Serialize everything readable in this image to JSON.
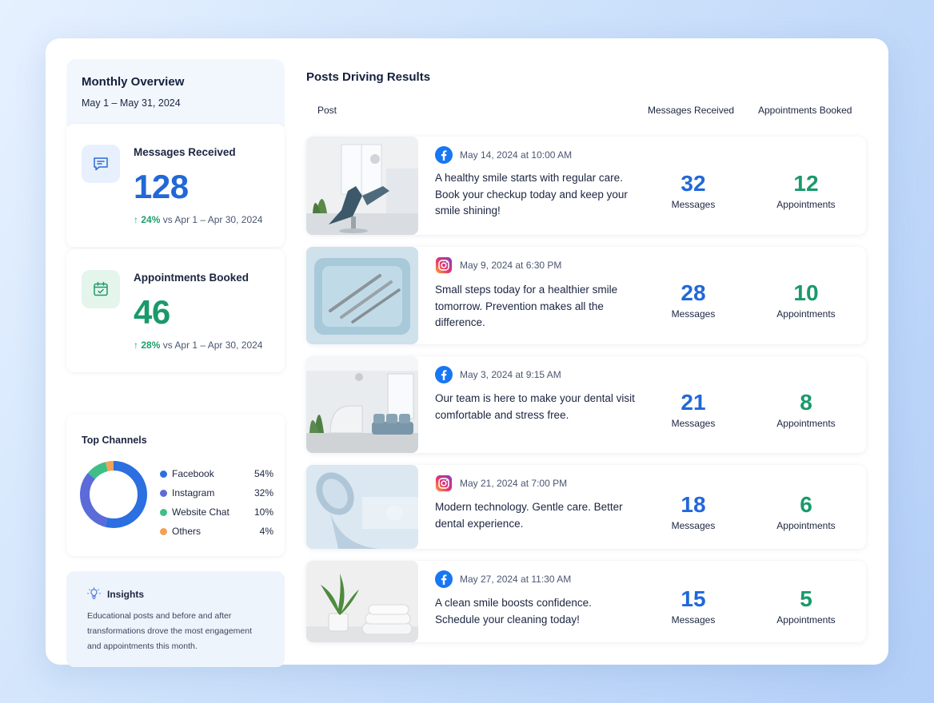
{
  "overview": {
    "title": "Monthly Overview",
    "date_range": "May 1 – May 31, 2024"
  },
  "stats": [
    {
      "label": "Messages Received",
      "value": "128",
      "change_pct": "24%",
      "change_text": "vs Apr 1 – Apr 30, 2024",
      "icon": "chat-icon",
      "color": "#2168d8"
    },
    {
      "label": "Appointments Booked",
      "value": "46",
      "change_pct": "28%",
      "change_text": "vs Apr 1 – Apr 30, 2024",
      "icon": "calendar-icon",
      "color": "#1a9a6a"
    }
  ],
  "channels": {
    "title": "Top Channels",
    "items": [
      {
        "name": "Facebook",
        "pct": "54%",
        "value": 54,
        "color": "#2b6fe0"
      },
      {
        "name": "Instagram",
        "pct": "32%",
        "value": 32,
        "color": "#5b6bd9"
      },
      {
        "name": "Website Chat",
        "pct": "10%",
        "value": 10,
        "color": "#3fbf87"
      },
      {
        "name": "Others",
        "pct": "4%",
        "value": 4,
        "color": "#f2a255"
      }
    ]
  },
  "insights": {
    "title": "Insights",
    "text": "Educational posts and before and after transformations drove the most engagement and appointments this month."
  },
  "posts": {
    "title": "Posts Driving Results",
    "columns": {
      "post": "Post",
      "messages": "Messages Received",
      "appointments": "Appointments Booked"
    },
    "messages_unit": "Messages",
    "appointments_unit": "Appointments",
    "rows": [
      {
        "platform": "facebook",
        "date": "May 14, 2024 at 10:00 AM",
        "caption": "A healthy smile starts with regular care. Book your checkup today and keep your smile shining!",
        "messages": "32",
        "appointments": "12",
        "image": "dental-chair-room"
      },
      {
        "platform": "instagram",
        "date": "May 9, 2024 at 6:30 PM",
        "caption": "Small steps today for a healthier smile tomorrow. Prevention makes all the difference.",
        "messages": "28",
        "appointments": "10",
        "image": "dental-tools-tray"
      },
      {
        "platform": "facebook",
        "date": "May 3, 2024 at 9:15 AM",
        "caption": "Our team is here to make your dental visit comfortable and stress free.",
        "messages": "21",
        "appointments": "8",
        "image": "clinic-reception"
      },
      {
        "platform": "instagram",
        "date": "May 21, 2024 at 7:00 PM",
        "caption": "Modern technology. Gentle care. Better dental experience.",
        "messages": "18",
        "appointments": "6",
        "image": "dental-lamp-closeup"
      },
      {
        "platform": "facebook",
        "date": "May 27, 2024 at 11:30 AM",
        "caption": "A clean smile boosts confidence. Schedule your cleaning today!",
        "messages": "15",
        "appointments": "5",
        "image": "plant-and-towels"
      }
    ]
  }
}
